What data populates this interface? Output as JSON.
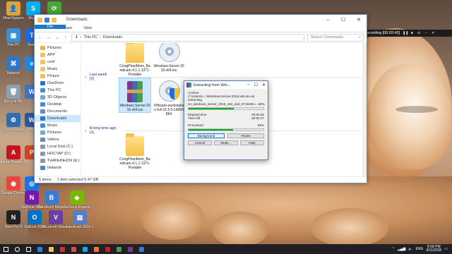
{
  "desktop": {
    "icons": [
      {
        "label": "Nhat Nguyen",
        "color": "#d9a441",
        "glyph": "👤"
      },
      {
        "label": "Skype",
        "color": "#00aff0",
        "glyph": "S"
      },
      {
        "label": "",
        "color": "#46a832",
        "glyph": "⟳"
      },
      {
        "label": "This PC",
        "color": "#3a8fd9",
        "glyph": "▣"
      },
      {
        "label": "Team",
        "color": "#1c6bd4",
        "glyph": "T"
      },
      {
        "label": "Network",
        "color": "#2f78c4",
        "glyph": "⌘"
      },
      {
        "label": "",
        "color": "#1e88e5",
        "glyph": "e"
      },
      {
        "label": "Recycle Bin",
        "color": "#8aa0b5",
        "glyph": "🗑"
      },
      {
        "label": "",
        "color": "#3b74c9",
        "glyph": "W"
      },
      {
        "label": "Control Panel",
        "color": "#2f6db3",
        "glyph": "⚙"
      },
      {
        "label": "Word",
        "color": "#2b579a",
        "glyph": "W"
      },
      {
        "label": "Adobe Reader XI",
        "color": "#c4151c",
        "glyph": "A"
      },
      {
        "label": "",
        "color": "#d04423",
        "glyph": "P"
      },
      {
        "label": "Google Chrome",
        "color": "#e8453c",
        "glyph": "◉"
      },
      {
        "label": "",
        "color": "#1a73e8",
        "glyph": "◎"
      },
      {
        "label": "OneNote 2016",
        "color": "#7719aa",
        "glyph": "N"
      },
      {
        "label": "Bandicam Mixdcap 3",
        "color": "#3a7bd5",
        "glyph": "B"
      },
      {
        "label": "GeForce Experience",
        "color": "#76b900",
        "glyph": "◆"
      },
      {
        "label": "Nero Pro 9",
        "color": "#222222",
        "glyph": "N"
      },
      {
        "label": "Outlook 2016",
        "color": "#0072c6",
        "glyph": "O"
      },
      {
        "label": "Microsoft Visual Studio",
        "color": "#6a3fa0",
        "glyph": "V"
      },
      {
        "label": "bandicam 2016-09-11",
        "color": "#5a7cc4",
        "glyph": "▤"
      }
    ]
  },
  "recorder": {
    "text": "Recording [00:02:43]"
  },
  "explorer": {
    "title": "Downloads",
    "tabs": [
      "File",
      "Home",
      "Share",
      "View"
    ],
    "breadcrumb": [
      "This PC",
      "Downloads"
    ],
    "search_placeholder": "Search Downloads",
    "nav_items": [
      {
        "label": "Pictures",
        "color": "#e9b63e",
        "selected": false
      },
      {
        "label": "APP",
        "color": "#f5c14a",
        "selected": false
      },
      {
        "label": "conf",
        "color": "#f5c14a",
        "selected": false
      },
      {
        "label": "Music",
        "color": "#f5c14a",
        "selected": false
      },
      {
        "label": "Picture",
        "color": "#f5c14a",
        "selected": false
      },
      {
        "label": "OneDrive",
        "color": "#1a73e8",
        "selected": false
      },
      {
        "label": "This PC",
        "color": "#3a8fd9",
        "selected": false
      },
      {
        "label": "3D Objects",
        "color": "#6aa8e0",
        "selected": false
      },
      {
        "label": "Desktop",
        "color": "#3a8fd9",
        "selected": false
      },
      {
        "label": "Documents",
        "color": "#6a88b0",
        "selected": false
      },
      {
        "label": "Downloads",
        "color": "#2f78c4",
        "selected": true
      },
      {
        "label": "Music",
        "color": "#3a8fd9",
        "selected": false
      },
      {
        "label": "Pictures",
        "color": "#6aa8e0",
        "selected": false
      },
      {
        "label": "Videos",
        "color": "#6a88b0",
        "selected": false
      },
      {
        "label": "Local Disk (C:)",
        "color": "#8a9bb0",
        "selected": false
      },
      {
        "label": "HOCTAP (D:)",
        "color": "#8a9bb0",
        "selected": false
      },
      {
        "label": "THANHNHON (E:)",
        "color": "#8a9bb0",
        "selected": false
      },
      {
        "label": "Network",
        "color": "#3a8fd9",
        "selected": false
      }
    ],
    "groups": {
      "top_files": [
        {
          "name": "CongPhanMem_Bandicam-4.1.1.1371-Portable",
          "kind": "folder"
        },
        {
          "name": "Windows.Server.2016.x64.iso",
          "kind": "disc"
        }
      ],
      "last_week": {
        "header": "Last week (2)",
        "files": [
          {
            "name": "Windows.Server.2016.x64.iso",
            "kind": "rar",
            "selected": true
          },
          {
            "name": "VMware-workstation-full-15.5.0-14665864",
            "kind": "vmware",
            "selected": false
          }
        ]
      },
      "long_ago": {
        "header": "A long time ago (1)",
        "files": [
          {
            "name": "CongPhanMem_Bandicam-4.1.1.1371-Portable",
            "kind": "folder",
            "selected": false
          }
        ]
      }
    },
    "status": {
      "count": "5 items",
      "selected": "1 item selected  5.47 GB"
    }
  },
  "extract_dialog": {
    "title": "Extracting from Win...",
    "archive_line": "Archive C:\\Users\\A...\\Windows.Server.2016.x64.iso.rar",
    "extracting_label": "extracting",
    "file_line": "en_windows_server_2016_x64_dvd_9718492.i...",
    "file_percent": "60%",
    "file_progress": 0.6,
    "elapsed_label": "Elapsed time",
    "elapsed_value": "00:00:26",
    "left_label": "Time left",
    "left_value": "00:00:17",
    "processed_label": "Processed",
    "processed_percent": "59%",
    "processed_progress": 0.59,
    "buttons": {
      "background": "Background",
      "pause": "Pause",
      "cancel": "Cancel",
      "mode": "Mode...",
      "help": "Help"
    }
  },
  "taskbar": {
    "apps": [
      {
        "name": "start",
        "color": "#ffffff"
      },
      {
        "name": "search",
        "color": "#ffffff"
      },
      {
        "name": "task-view",
        "color": "#ffffff"
      },
      {
        "name": "edge",
        "color": "#1e88e5"
      },
      {
        "name": "explorer",
        "color": "#f5c14a"
      },
      {
        "name": "opera",
        "color": "#e0262f"
      },
      {
        "name": "chrome",
        "color": "#e8453c"
      },
      {
        "name": "skype",
        "color": "#00aff0"
      },
      {
        "name": "firefox",
        "color": "#ff7139"
      },
      {
        "name": "bandicam",
        "color": "#e81123"
      },
      {
        "name": "app",
        "color": "#4aa04a"
      },
      {
        "name": "winrar",
        "color": "#7a3b8f"
      },
      {
        "name": "mail",
        "color": "#3a7bd5"
      }
    ],
    "lang": "ENG",
    "time": "8:58 PM",
    "date": "9/11/2020"
  }
}
